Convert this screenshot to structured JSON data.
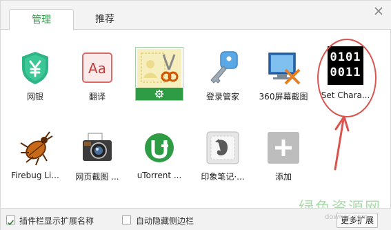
{
  "tabs": [
    {
      "label": "管理",
      "active": true
    },
    {
      "label": "推荐",
      "active": false
    }
  ],
  "extensions_row1": [
    {
      "label": "网银",
      "icon": "shield-yen-icon"
    },
    {
      "label": "翻译",
      "icon": "translate-aa-icon"
    },
    {
      "label": "",
      "icon": "screenshot-scissors-icon",
      "selected": true
    },
    {
      "label": "登录管家",
      "icon": "key-icon"
    },
    {
      "label": "360屏幕截图",
      "icon": "screen-capture-icon"
    },
    {
      "label": "Set Chara...",
      "icon": "binary-icon",
      "binary_lines": [
        "0101",
        "0011"
      ]
    }
  ],
  "extensions_row2": [
    {
      "label": "Firebug Li...",
      "icon": "firebug-icon"
    },
    {
      "label": "网页截图 ...",
      "icon": "camera-icon"
    },
    {
      "label": "uTorrent ...",
      "icon": "utorrent-icon"
    },
    {
      "label": "印象笔记·...",
      "icon": "evernote-icon"
    },
    {
      "label": "添加",
      "icon": "add-plus-icon"
    }
  ],
  "footer": {
    "show_names_label": "插件栏显示扩展名称",
    "show_names_checked": true,
    "auto_hide_label": "自动隐藏侧边栏",
    "auto_hide_checked": false,
    "more_button": "更多扩展"
  },
  "watermark": {
    "text": "绿色资源网",
    "url": "downcc.com"
  },
  "colors": {
    "accent_green": "#2e9b45",
    "annotation_red": "#d9534f"
  }
}
